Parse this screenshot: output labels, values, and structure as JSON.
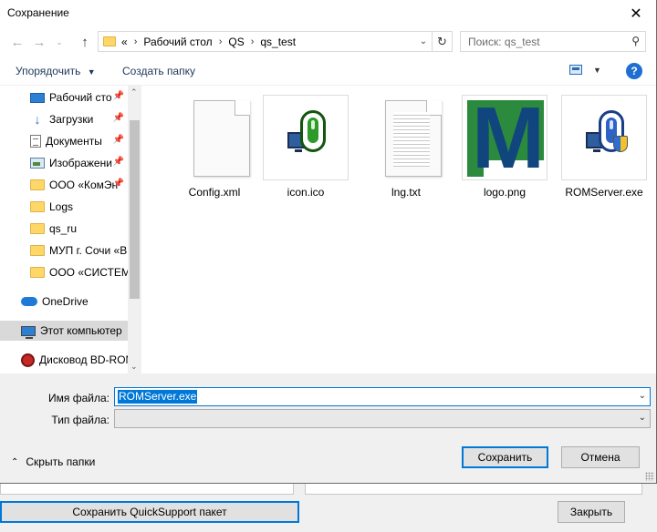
{
  "window": {
    "title": "Сохранение",
    "close_glyph": "✕"
  },
  "nav": {
    "back_glyph": "←",
    "forward_glyph": "→",
    "recent_glyph": "⌄",
    "up_glyph": "↑"
  },
  "address": {
    "overflow": "«",
    "separator": "›",
    "crumbs": [
      "Рабочий стол",
      "QS",
      "qs_test"
    ],
    "dropdown_glyph": "⌄",
    "refresh_glyph": "↻"
  },
  "search": {
    "placeholder": "Поиск: qs_test",
    "icon_glyph": "⚲"
  },
  "toolbar": {
    "organize_label": "Упорядочить",
    "organize_arrow": "▼",
    "new_folder_label": "Создать папку",
    "view_drop_glyph": "▼",
    "help_label": "?"
  },
  "sidebar": {
    "pin_glyph": "📌",
    "scroll_up": "⌃",
    "scroll_down": "⌄",
    "items": [
      {
        "label": "Рабочий сто",
        "icon": "desktop-icon",
        "pinned": true
      },
      {
        "label": "Загрузки",
        "icon": "download-icon",
        "pinned": true
      },
      {
        "label": "Документы",
        "icon": "documents-icon",
        "pinned": true
      },
      {
        "label": "Изображени",
        "icon": "images-icon",
        "pinned": true
      },
      {
        "label": "ООО «КомЭн",
        "icon": "folder-icon",
        "pinned": true
      },
      {
        "label": "Logs",
        "icon": "folder-icon",
        "pinned": false
      },
      {
        "label": "qs_ru",
        "icon": "folder-icon",
        "pinned": false
      },
      {
        "label": "МУП г. Сочи «В",
        "icon": "folder-icon",
        "pinned": false
      },
      {
        "label": "ООО «СИСТЕМ",
        "icon": "folder-icon",
        "pinned": false
      },
      {
        "label": "OneDrive",
        "icon": "onedrive-icon",
        "pinned": false
      },
      {
        "label": "Этот компьютер",
        "icon": "computer-icon",
        "pinned": false,
        "selected": true
      },
      {
        "label": "Дисковод BD-ROM",
        "icon": "disc-drive-icon",
        "pinned": false
      }
    ]
  },
  "files": [
    {
      "name": "Config.xml",
      "icon": "xml-file-icon"
    },
    {
      "name": "icon.ico",
      "icon": "ico-file-icon"
    },
    {
      "name": "lng.txt",
      "icon": "text-file-icon"
    },
    {
      "name": "logo.png",
      "icon": "png-file-icon",
      "logo_letter": "M"
    },
    {
      "name": "ROMServer.exe",
      "icon": "exe-file-icon"
    }
  ],
  "form": {
    "filename_label": "Имя файла:",
    "filename_value": "ROMServer.exe",
    "filetype_label": "Тип файла:",
    "filetype_value": "",
    "dropdown_glyph": "⌄",
    "hide_folders_label": "Скрыть папки",
    "hide_folders_glyph": "⌃",
    "save_label": "Сохранить",
    "cancel_label": "Отмена"
  },
  "background_app": {
    "save_package_label": "Сохранить QuickSupport пакет",
    "close_label": "Закрыть"
  },
  "colors": {
    "accent": "#0078d7",
    "selection": "#d9d9d9",
    "help": "#1f6fd2"
  }
}
